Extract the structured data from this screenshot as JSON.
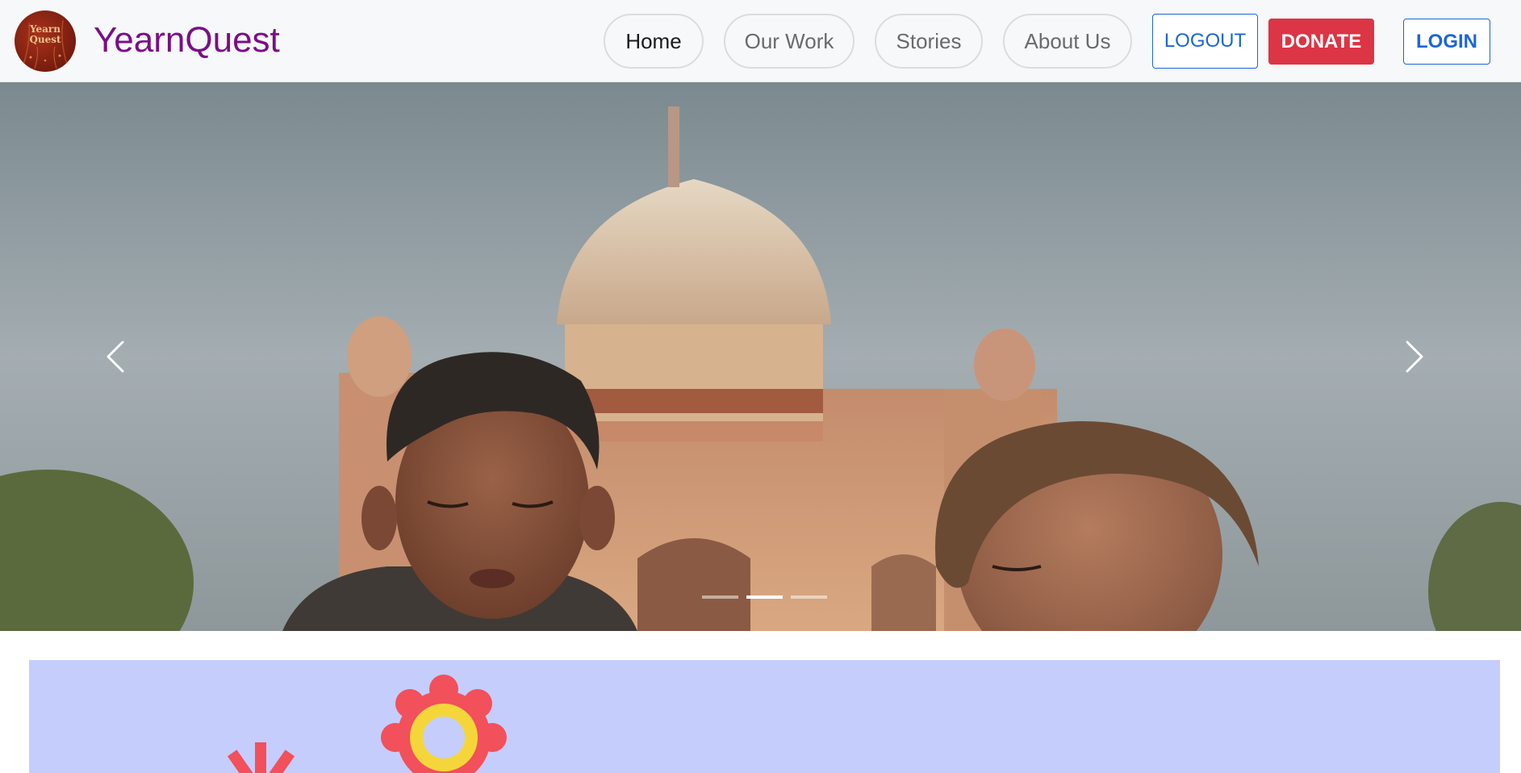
{
  "header": {
    "logo_text": "Yearn\nQuest",
    "brand": "YearnQuest",
    "nav": [
      {
        "label": "Home",
        "active": true
      },
      {
        "label": "Our Work",
        "active": false
      },
      {
        "label": "Stories",
        "active": false
      },
      {
        "label": "About Us",
        "active": false
      }
    ],
    "logout_label": "LOGOUT",
    "donate_label": "DONATE",
    "login_label": "LOGIN"
  },
  "carousel": {
    "slide_count": 3,
    "active_slide": 2,
    "prev_icon": "chevron-left-icon",
    "next_icon": "chevron-right-icon"
  },
  "colors": {
    "brand": "#7a0f86",
    "primary": "#1a66d8",
    "donate": "#dc3545",
    "banner_bg": "#c5cdfd"
  }
}
